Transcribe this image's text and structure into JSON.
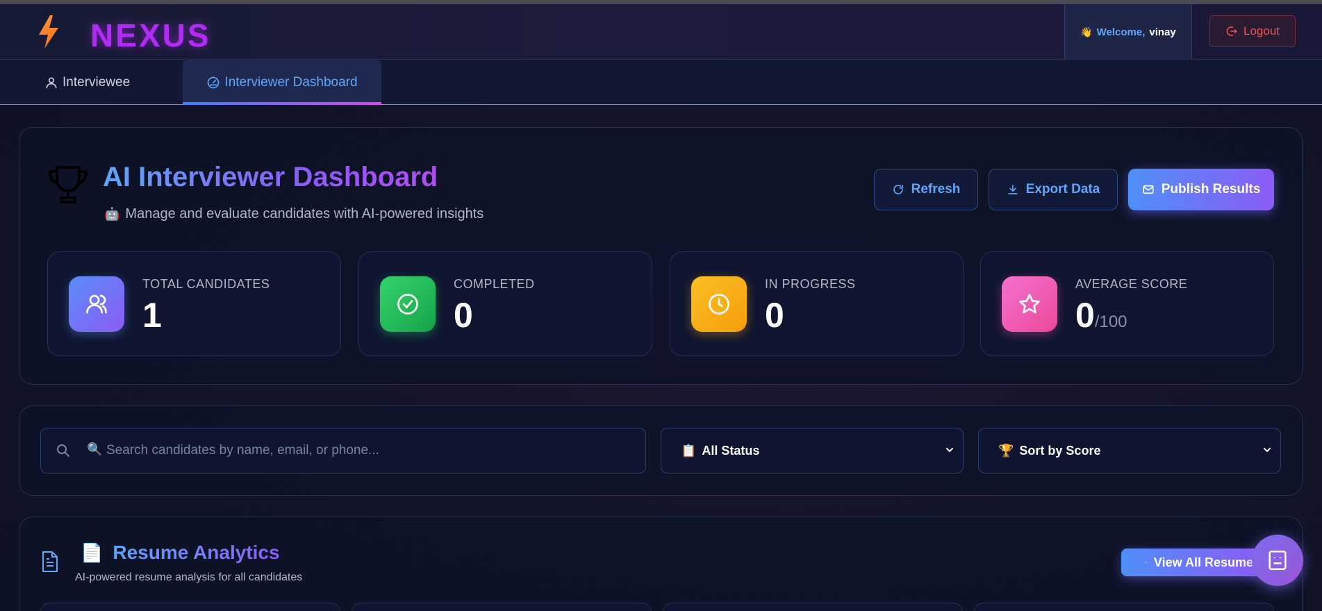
{
  "header": {
    "logo_text": "NEXUS",
    "welcome_emoji": "👋",
    "welcome_label": "Welcome,",
    "username": "vinay",
    "logout_label": "Logout"
  },
  "tabs": [
    {
      "label": "Interviewee",
      "active": false
    },
    {
      "label": "Interviewer Dashboard",
      "active": true
    }
  ],
  "dashboard": {
    "title": "AI Interviewer Dashboard",
    "subtitle_emoji": "🤖",
    "subtitle": "Manage and evaluate candidates with AI-powered insights",
    "refresh_label": "Refresh",
    "export_label": "Export Data",
    "publish_label": "Publish Results"
  },
  "stats": [
    {
      "label": "TOTAL CANDIDATES",
      "value": "1",
      "icon": "users-icon",
      "color": "#6b7ff7"
    },
    {
      "label": "COMPLETED",
      "value": "0",
      "icon": "check-circle-icon",
      "color": "#22c55e"
    },
    {
      "label": "IN PROGRESS",
      "value": "0",
      "icon": "clock-icon",
      "color": "#f59e0b"
    },
    {
      "label": "AVERAGE SCORE",
      "value": "0",
      "suffix": "/100",
      "icon": "star-icon",
      "color": "#ec4899"
    }
  ],
  "filters": {
    "search_placeholder": "Search candidates by name, email, or phone...",
    "search_emoji": "🔍",
    "status_emoji": "📋",
    "status_selected": "All Status",
    "sort_emoji": "🏆",
    "sort_selected": "Sort by Score"
  },
  "resume": {
    "title_emoji": "📄",
    "title": "Resume Analytics",
    "subtitle": "AI-powered resume analysis for all candidates",
    "view_all_label": "View All Resumes"
  },
  "colors": {
    "accent_blue": "#60a5fa",
    "accent_purple": "#8b5cf6",
    "logo_magenta": "#b02cf5",
    "logout_red": "#f05252"
  }
}
